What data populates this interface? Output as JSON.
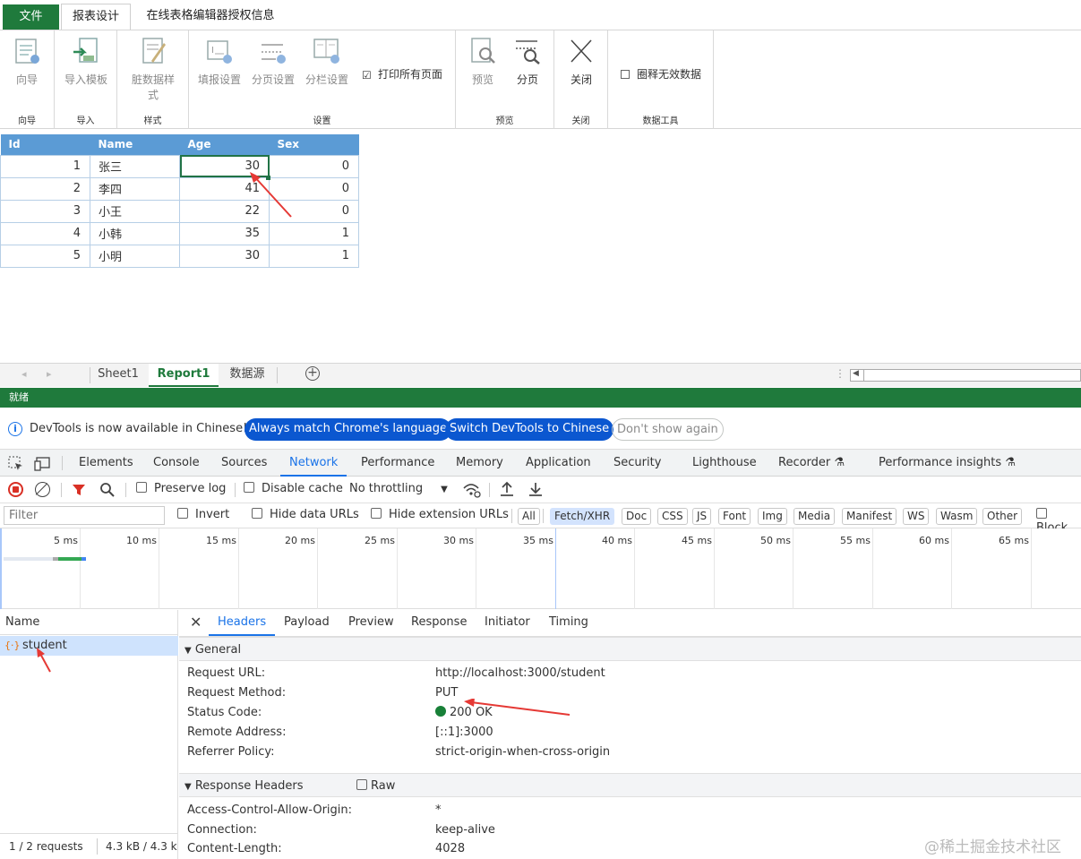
{
  "ribbon": {
    "tabs": {
      "file": "文件",
      "report_design": "报表设计",
      "license": "在线表格编辑器授权信息"
    },
    "buttons": {
      "wizard": "向导",
      "import_template": "导入模板",
      "dirty_style": "脏数据样式",
      "fill_settings": "填报设置",
      "page_settings": "分页设置",
      "column_settings": "分栏设置",
      "print_all_pages": "打印所有页面",
      "preview": "预览",
      "paging": "分页",
      "close": "关闭",
      "circle_invalid": "圈释无效数据"
    },
    "groups": {
      "wizard": "向导",
      "import": "导入",
      "style": "样式",
      "settings": "设置",
      "preview": "预览",
      "close": "关闭",
      "data_tools": "数据工具"
    }
  },
  "grid": {
    "headers": [
      "Id",
      "Name",
      "Age",
      "Sex"
    ],
    "rows": [
      [
        "1",
        "张三",
        "30",
        "0"
      ],
      [
        "2",
        "李四",
        "41",
        "0"
      ],
      [
        "3",
        "小王",
        "22",
        "0"
      ],
      [
        "4",
        "小韩",
        "35",
        "1"
      ],
      [
        "5",
        "小明",
        "30",
        "1"
      ]
    ]
  },
  "sheets": {
    "sheet1": "Sheet1",
    "report1": "Report1",
    "datasource": "数据源"
  },
  "status": "就绪",
  "devtools": {
    "notice": {
      "text": "DevTools is now available in Chinese!",
      "match": "Always match Chrome's language",
      "switch": "Switch DevTools to Chinese",
      "dismiss": "Don't show again"
    },
    "tabs": [
      "Elements",
      "Console",
      "Sources",
      "Network",
      "Performance",
      "Memory",
      "Application",
      "Security",
      "Lighthouse",
      "Recorder",
      "Performance insights"
    ],
    "toolbar": {
      "preserve_log": "Preserve log",
      "disable_cache": "Disable cache",
      "throttling": "No throttling"
    },
    "filter": {
      "placeholder": "Filter",
      "invert": "Invert",
      "hide_data_urls": "Hide data URLs",
      "hide_ext_urls": "Hide extension URLs",
      "types": [
        "All",
        "Fetch/XHR",
        "Doc",
        "CSS",
        "JS",
        "Font",
        "Img",
        "Media",
        "Manifest",
        "WS",
        "Wasm",
        "Other"
      ],
      "block": "Block"
    },
    "timeline": [
      "5 ms",
      "10 ms",
      "15 ms",
      "20 ms",
      "25 ms",
      "30 ms",
      "35 ms",
      "40 ms",
      "45 ms",
      "50 ms",
      "55 ms",
      "60 ms",
      "65 ms"
    ],
    "requests": {
      "column": "Name",
      "item": "student",
      "summary": "1 / 2 requests",
      "size": "4.3 kB / 4.3 k"
    },
    "detail_tabs": [
      "Headers",
      "Payload",
      "Preview",
      "Response",
      "Initiator",
      "Timing"
    ],
    "general": {
      "title": "General",
      "rows": [
        {
          "k": "Request URL:",
          "v": "http://localhost:3000/student"
        },
        {
          "k": "Request Method:",
          "v": "PUT"
        },
        {
          "k": "Status Code:",
          "v": "200 OK"
        },
        {
          "k": "Remote Address:",
          "v": "[::1]:3000"
        },
        {
          "k": "Referrer Policy:",
          "v": "strict-origin-when-cross-origin"
        }
      ]
    },
    "response_headers": {
      "title": "Response Headers",
      "raw": "Raw",
      "rows": [
        {
          "k": "Access-Control-Allow-Origin:",
          "v": "*"
        },
        {
          "k": "Connection:",
          "v": "keep-alive"
        },
        {
          "k": "Content-Length:",
          "v": "4028"
        }
      ]
    }
  },
  "watermark": "@稀土掘金技术社区"
}
